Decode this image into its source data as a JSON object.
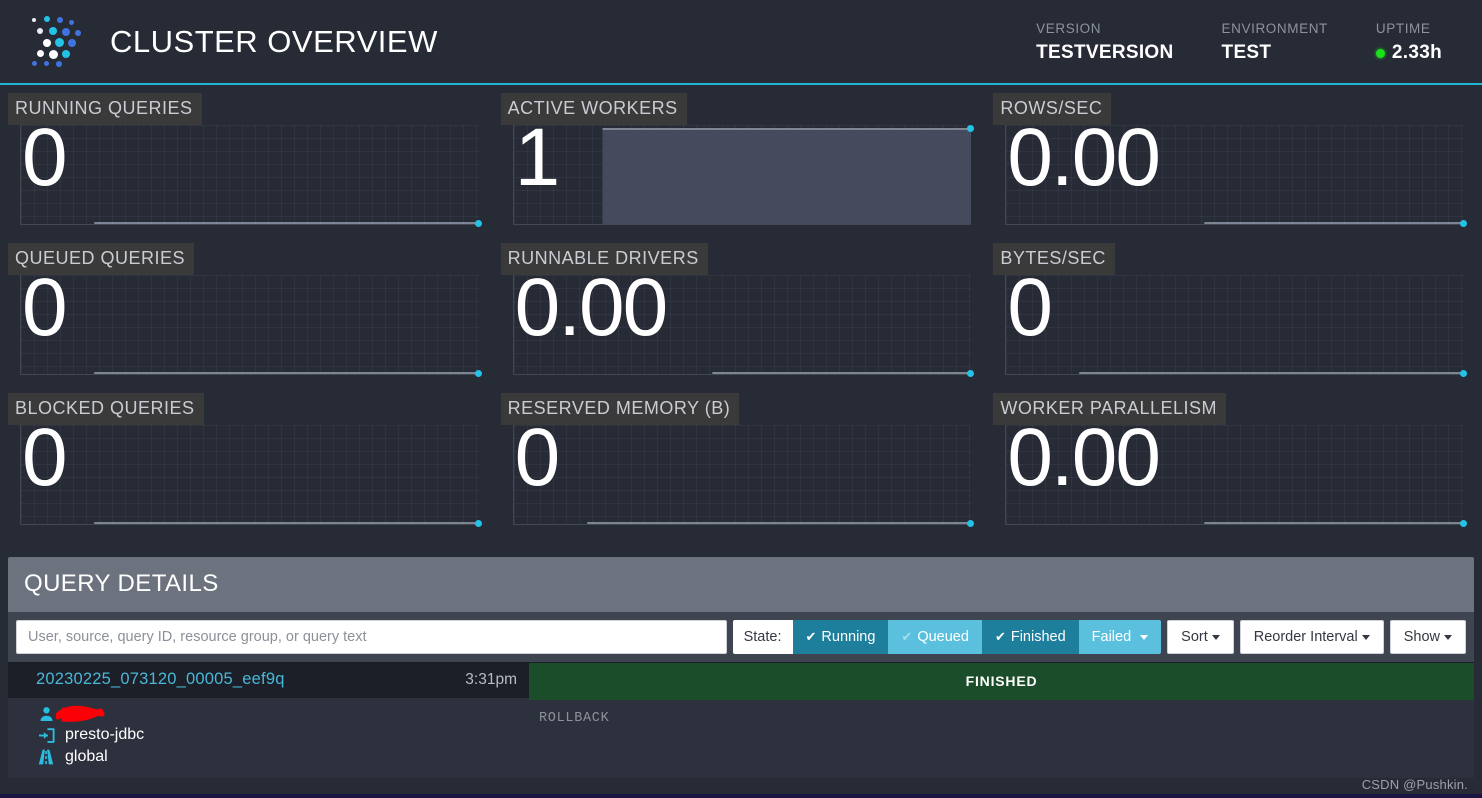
{
  "header": {
    "logo_icon": "presto-dots-logo-icon",
    "title": "CLUSTER OVERVIEW",
    "accent_color": "#1fb6d3",
    "meta": [
      {
        "label": "VERSION",
        "value": "TESTVERSION"
      },
      {
        "label": "ENVIRONMENT",
        "value": "TEST"
      },
      {
        "label": "UPTIME",
        "value": "2.33h",
        "dot": true,
        "dot_color": "#19e019"
      }
    ]
  },
  "stats": [
    {
      "title": "RUNNING QUERIES",
      "value": "0",
      "spark": "flat-low",
      "fill": false
    },
    {
      "title": "ACTIVE WORKERS",
      "value": "1",
      "spark": "flat-high",
      "fill": true
    },
    {
      "title": "ROWS/SEC",
      "value": "0.00",
      "spark": "flat-low",
      "fill": false
    },
    {
      "title": "QUEUED QUERIES",
      "value": "0",
      "spark": "flat-low",
      "fill": false
    },
    {
      "title": "RUNNABLE DRIVERS",
      "value": "0.00",
      "spark": "flat-low",
      "fill": false
    },
    {
      "title": "BYTES/SEC",
      "value": "0",
      "spark": "flat-low",
      "fill": false
    },
    {
      "title": "BLOCKED QUERIES",
      "value": "0",
      "spark": "flat-low",
      "fill": false
    },
    {
      "title": "RESERVED MEMORY (B)",
      "value": "0",
      "spark": "flat-low",
      "fill": false
    },
    {
      "title": "WORKER PARALLELISM",
      "value": "0.00",
      "spark": "flat-low",
      "fill": false
    }
  ],
  "chart_data": [
    {
      "type": "line",
      "title": "RUNNING QUERIES",
      "values": [
        0,
        0,
        0,
        0,
        0,
        0,
        0,
        0,
        0,
        0,
        0,
        0
      ],
      "ylim": [
        0,
        1
      ],
      "grid": true,
      "last_point": 0
    },
    {
      "type": "area",
      "title": "ACTIVE WORKERS",
      "values": [
        1,
        1,
        1,
        1,
        1,
        1,
        1,
        1,
        1,
        1,
        1,
        1
      ],
      "ylim": [
        0,
        1
      ],
      "grid": true,
      "last_point": 1
    },
    {
      "type": "line",
      "title": "ROWS/SEC",
      "values": [
        0,
        0,
        0,
        0,
        0,
        0,
        0,
        0,
        0,
        0,
        0,
        0
      ],
      "ylim": [
        0,
        1
      ],
      "grid": true,
      "last_point": 0
    },
    {
      "type": "line",
      "title": "QUEUED QUERIES",
      "values": [
        0,
        0,
        0,
        0,
        0,
        0,
        0,
        0,
        0,
        0,
        0,
        0
      ],
      "ylim": [
        0,
        1
      ],
      "grid": true,
      "last_point": 0
    },
    {
      "type": "line",
      "title": "RUNNABLE DRIVERS",
      "values": [
        0,
        0,
        0,
        0,
        0,
        0,
        0,
        0,
        0,
        0,
        0,
        0
      ],
      "ylim": [
        0,
        1
      ],
      "grid": true,
      "last_point": 0
    },
    {
      "type": "line",
      "title": "BYTES/SEC",
      "values": [
        0,
        0,
        0,
        0,
        0,
        0,
        0,
        0,
        0,
        0,
        0,
        0
      ],
      "ylim": [
        0,
        1
      ],
      "grid": true,
      "last_point": 0
    },
    {
      "type": "line",
      "title": "BLOCKED QUERIES",
      "values": [
        0,
        0,
        0,
        0,
        0,
        0,
        0,
        0,
        0,
        0,
        0,
        0
      ],
      "ylim": [
        0,
        1
      ],
      "grid": true,
      "last_point": 0
    },
    {
      "type": "line",
      "title": "RESERVED MEMORY (B)",
      "values": [
        0,
        0,
        0,
        0,
        0,
        0,
        0,
        0,
        0,
        0,
        0,
        0
      ],
      "ylim": [
        0,
        1
      ],
      "grid": true,
      "last_point": 0
    },
    {
      "type": "line",
      "title": "WORKER PARALLELISM",
      "values": [
        0,
        0,
        0,
        0,
        0,
        0,
        0,
        0,
        0,
        0,
        0,
        0
      ],
      "ylim": [
        0,
        1
      ],
      "grid": true,
      "last_point": 0
    }
  ],
  "query_details": {
    "heading": "QUERY DETAILS",
    "search": {
      "value": "",
      "placeholder": "User, source, query ID, resource group, or query text"
    },
    "state_label": "State:",
    "state_filters": [
      {
        "label": "Running",
        "checked": true,
        "active": true,
        "caret": false
      },
      {
        "label": "Queued",
        "checked": true,
        "active": false,
        "caret": false
      },
      {
        "label": "Finished",
        "checked": true,
        "active": true,
        "caret": false
      },
      {
        "label": "Failed",
        "checked": false,
        "active": false,
        "caret": true
      }
    ],
    "buttons": [
      {
        "label": "Sort",
        "caret": true
      },
      {
        "label": "Reorder Interval",
        "caret": true
      },
      {
        "label": "Show",
        "caret": true
      }
    ],
    "rows": [
      {
        "query_id": "20230225_073120_00005_eef9q",
        "time": "3:31pm",
        "state": "FINISHED",
        "state_color": "#1c4d2a",
        "query_text": "ROLLBACK",
        "user": "",
        "user_redacted": true,
        "source": "presto-jdbc",
        "resource_group": "global",
        "user_icon": "user-icon",
        "source_icon": "sign-in-icon",
        "resource_group_icon": "road-icon"
      }
    ]
  },
  "watermark": "CSDN @Pushkin."
}
